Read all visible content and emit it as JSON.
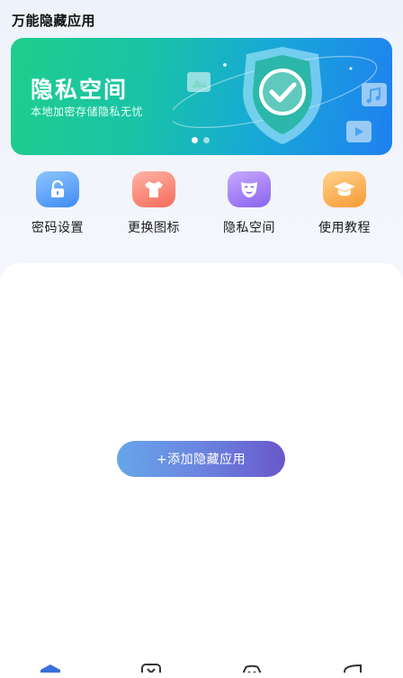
{
  "app": {
    "title": "万能隐藏应用"
  },
  "banner": {
    "title": "隐私空间",
    "subtitle": "本地加密存储隐私无忧",
    "dots": 2,
    "active_dot": 1
  },
  "shortcuts": [
    {
      "label": "密码设置",
      "icon": "lock-icon",
      "color": "#4f97f6"
    },
    {
      "label": "更换图标",
      "icon": "shirt-icon",
      "color": "#f6796a"
    },
    {
      "label": "隐私空间",
      "icon": "mask-icon",
      "color": "#9570f0"
    },
    {
      "label": "使用教程",
      "icon": "graduation-cap-icon",
      "color": "#fba441"
    }
  ],
  "main": {
    "add_button_label": "+添加隐藏应用"
  },
  "tabbar": {
    "tabs": [
      {
        "icon": "home-icon",
        "active": true
      },
      {
        "icon": "app-icon",
        "active": false
      },
      {
        "icon": "chat-icon",
        "active": false
      },
      {
        "icon": "profile-icon",
        "active": false
      }
    ],
    "active_color": "#3a6fd8"
  }
}
